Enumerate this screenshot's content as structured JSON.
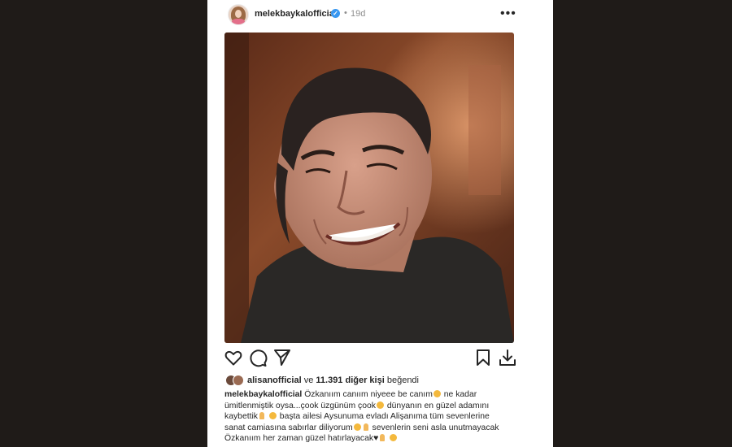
{
  "post": {
    "username": "melekbaykalofficial",
    "verified_icon": "verified-badge-icon",
    "separator": "•",
    "time": "19d",
    "more_label": "•••"
  },
  "photo": {
    "icon": "photo-portrait-man-smiling",
    "colors": {
      "background": "#7a3b22",
      "sweater": "#2b2a28",
      "skin": "#c98d72"
    }
  },
  "actions": {
    "icons": [
      "heart-icon",
      "comment-icon",
      "share-icon",
      "bookmark-icon",
      "download-icon"
    ]
  },
  "likes": {
    "user": "alisanofficial",
    "conjunction": "ve",
    "count_text": "11.391 diğer kişi",
    "suffix": "beğendi"
  },
  "caption": {
    "username": "melekbaykalofficial",
    "line1": "Özkanıım canıım niyeee be canım",
    "line1b": "ne kadar",
    "line2": "ümitlenmiştik oysa...çook üzgünüm çook",
    "line2b": "dünyanın en güzel adamını",
    "line3": "kaybettik",
    "line3b": "başta ailesi Aysunuma evladı Alişanıma tüm sevenlerine",
    "line4": "sanat camiasına sabırlar diliyorum",
    "line4b": "sevenlerin seni asla unutmayacak",
    "line5": "Özkanıım her zaman güzel hatırlayacak♥"
  },
  "colors": {
    "page_bg": "#1f1b18",
    "card_bg": "#ffffff",
    "text": "#262626",
    "muted": "#8e8e8e",
    "verified": "#3897f0"
  }
}
